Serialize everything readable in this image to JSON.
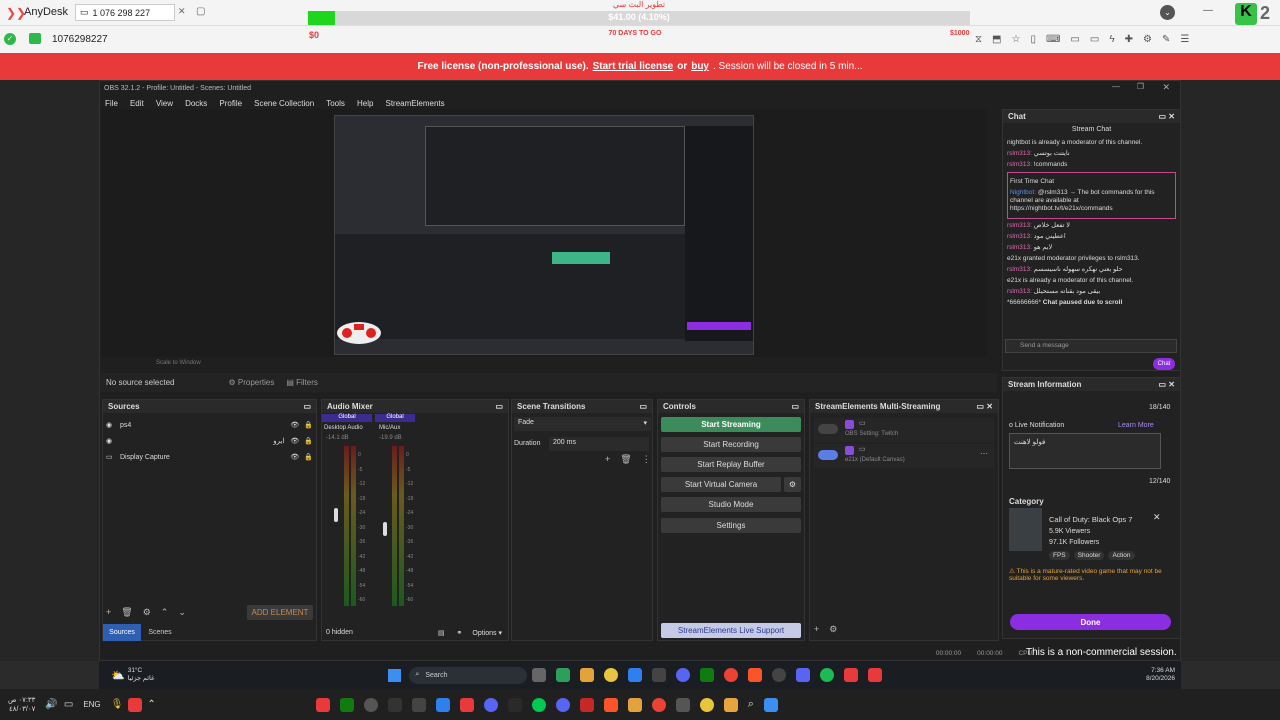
{
  "anydesk": {
    "app_name": "AnyDesk",
    "address_tab": "1 076 298 227",
    "session_id": "1076298227",
    "goal_title": "تطوير البث سي",
    "goal_amount": "$41.00 (4.10%)",
    "goal_start": "$0",
    "goal_days": "70 DAYS TO GO",
    "goal_end": "$1000",
    "goal_progress": 0.041,
    "corner_digit": "2"
  },
  "license_banner": {
    "prefix": "Free license (non-professional use).",
    "link1": "Start trial license",
    "or": "or",
    "link2": "buy",
    "suffix": ". Session will be closed in 5 min..."
  },
  "obs": {
    "title": "OBS 32.1.2 - Profile: Untitled - Scenes: Untitled",
    "menu": [
      "File",
      "Edit",
      "View",
      "Docks",
      "Profile",
      "Scene Collection",
      "Tools",
      "Help",
      "StreamElements"
    ],
    "no_source": "No source selected",
    "properties": "Properties",
    "filters": "Filters",
    "preview_zoom": "Scale to Window",
    "sources": {
      "title": "Sources",
      "items": [
        "ps4",
        "ايرو",
        "Display Capture"
      ],
      "add_element": "ADD ELEMENT",
      "tab_sources": "Sources",
      "tab_scenes": "Scenes"
    },
    "mixer": {
      "title": "Audio Mixer",
      "ch1_tag": "Global",
      "ch1_name": "Desktop Audio",
      "ch1_db": "-14.1 dB",
      "ch2_tag": "Global",
      "ch2_name": "Mic/Aux",
      "ch2_db": "-19.9 dB",
      "scale": [
        "0",
        "-5",
        "-12",
        "-18",
        "-24",
        "-30",
        "-36",
        "-42",
        "-48",
        "-54",
        "-60"
      ],
      "hidden": "0 hidden",
      "options": "Options"
    },
    "transitions": {
      "title": "Scene Transitions",
      "type": "Fade",
      "duration_label": "Duration",
      "duration_value": "200 ms"
    },
    "controls": {
      "title": "Controls",
      "start_streaming": "Start Streaming",
      "start_recording": "Start Recording",
      "replay_buffer": "Start Replay Buffer",
      "virtual_camera": "Start Virtual Camera",
      "studio_mode": "Studio Mode",
      "settings": "Settings",
      "se_support": "StreamElements Live Support"
    },
    "multistream": {
      "title": "StreamElements Multi-Streaming",
      "row1_sub": "OBS Setting: Twitch",
      "row2_sub": "e21x (Default Canvas)"
    },
    "chat": {
      "title": "Chat",
      "header": "Stream Chat",
      "lines": [
        {
          "user": "",
          "text": "nightbot is already a moderator of this channel."
        },
        {
          "user": "rslm313:",
          "text": "نايتنت بوتسي"
        },
        {
          "user": "rslm313:",
          "text": "!commands"
        },
        {
          "user": "",
          "text": "First Time Chat"
        },
        {
          "user": "Nightbot:",
          "text": "@rslm313 → The bot commands for this channel are available at https://nightbot.tv/t/e21x/commands"
        },
        {
          "user": "rslm313:",
          "text": "لا تفعل خلاص"
        },
        {
          "user": "rslm313:",
          "text": "اعطيني مود"
        },
        {
          "user": "rslm313:",
          "text": "لايم هو"
        },
        {
          "user": "",
          "text": "e21x granted moderator privileges to rslm313."
        },
        {
          "user": "rslm313:",
          "text": "حلو بعني نهكره سهوله ناسيسسم"
        },
        {
          "user": "",
          "text": "e21x is already a moderator of this channel."
        },
        {
          "user": "rslm313:",
          "text": "بيقى مود بقناته مستحيلل"
        },
        {
          "user": "",
          "text": "*66666666*"
        }
      ],
      "paused": "Chat paused due to scroll",
      "placeholder": "Send a message",
      "send": "Chat"
    },
    "stream_info": {
      "title": "Stream Information",
      "title_count": "18/140",
      "notif_label": "o Live Notification",
      "learn_more": "Learn More",
      "notif_text": "فولو لاهنت",
      "notif_count": "12/140",
      "category_label": "Category",
      "game": "Call of Duty: Black Ops 7",
      "viewers": "5.9K Viewers",
      "followers": "97.1K Followers",
      "tags": [
        "FPS",
        "Shooter",
        "Action"
      ],
      "warning": "This is a mature-rated video game that may not be suitable for some viewers.",
      "done": "Done"
    },
    "status": {
      "time1": "00:00:00",
      "time2": "00:00:00",
      "cpu": "CPU:"
    }
  },
  "noncommercial": "This is a non-commercial session.",
  "inner_taskbar": {
    "weather_temp": "31°C",
    "weather_desc": "غائم جزئيا",
    "search": "Search",
    "time": "7:36 AM",
    "date": "8/20/2026"
  },
  "host_taskbar": {
    "time": "٠٧:٣٣ ص",
    "date": "٤٨/٠٣/٠٧",
    "lang": "ENG"
  }
}
